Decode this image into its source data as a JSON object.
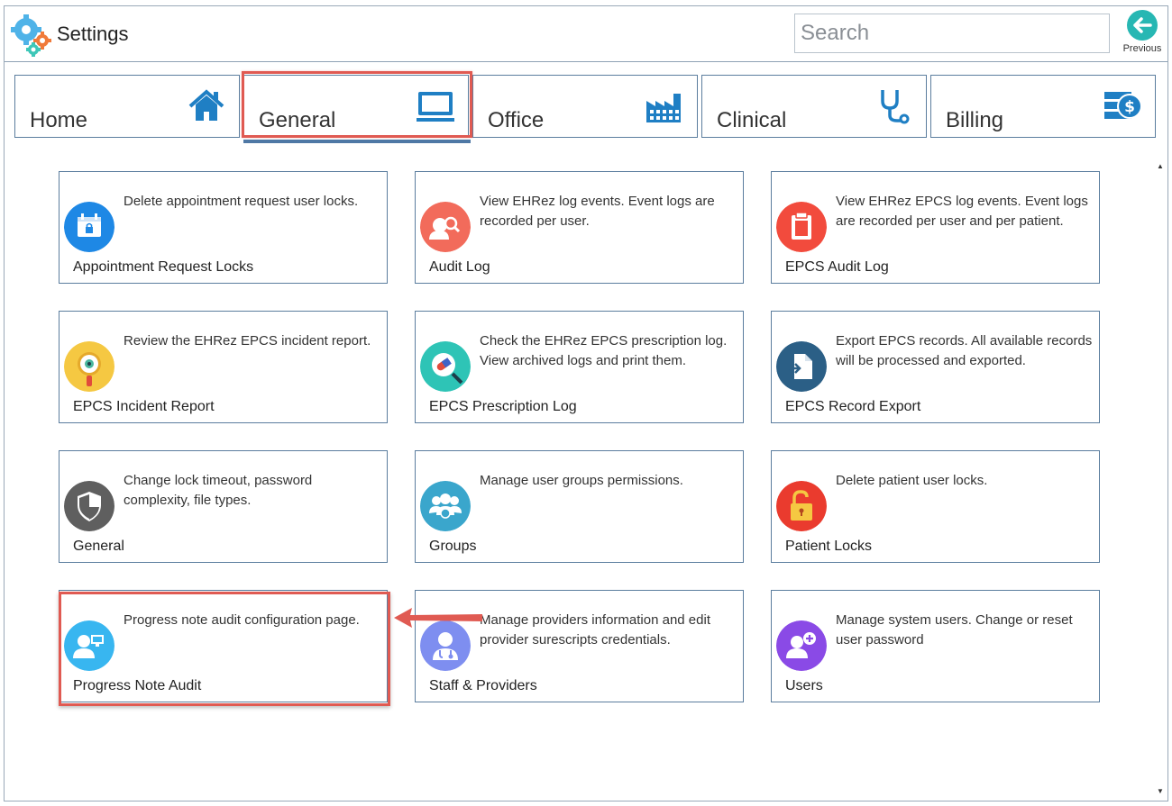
{
  "app": {
    "title": "Settings"
  },
  "search": {
    "placeholder": "Search"
  },
  "previous": {
    "label": "Previous"
  },
  "tabs": [
    {
      "label": "Home",
      "icon": "home-icon"
    },
    {
      "label": "General",
      "icon": "monitor-icon",
      "active": true
    },
    {
      "label": "Office",
      "icon": "factory-icon"
    },
    {
      "label": "Clinical",
      "icon": "stethoscope-icon"
    },
    {
      "label": "Billing",
      "icon": "billing-icon"
    }
  ],
  "tiles": [
    {
      "title": "Appointment Request Locks",
      "description": "Delete appointment request user locks.",
      "icon": "calendar-lock-icon",
      "color": "#1e88e5"
    },
    {
      "title": "Audit Log",
      "description": "View EHRez log events. Event logs are recorded per user.",
      "icon": "user-search-icon",
      "color": "#f26b5b"
    },
    {
      "title": "EPCS Audit Log",
      "description": "View EHRez EPCS log events. Event logs are recorded per user and per patient.",
      "icon": "clipboard-icon",
      "color": "#f24b3d"
    },
    {
      "title": "EPCS Incident Report",
      "description": "Review the EHRez EPCS incident report.",
      "icon": "magnifier-eye-icon",
      "color": "#f5c842"
    },
    {
      "title": "EPCS Prescription Log",
      "description": "Check the EHRez EPCS prescription log. View archived logs and print them.",
      "icon": "pill-search-icon",
      "color": "#2ec4b6"
    },
    {
      "title": "EPCS Record Export",
      "description": "Export EPCS records. All available records will be processed and exported.",
      "icon": "export-document-icon",
      "color": "#2b5f86"
    },
    {
      "title": "General",
      "description": "Change lock timeout, password complexity, file types.",
      "icon": "shield-icon",
      "color": "#5f5f5f"
    },
    {
      "title": "Groups",
      "description": "Manage user groups permissions.",
      "icon": "group-icon",
      "color": "#3aa6cc"
    },
    {
      "title": "Patient Locks",
      "description": "Delete patient user locks.",
      "icon": "padlock-open-icon",
      "color": "#ea3b2e"
    },
    {
      "title": "Progress Note Audit",
      "description": "Progress note audit configuration page.",
      "icon": "user-monitor-icon",
      "color": "#38b6f0"
    },
    {
      "title": "Staff & Providers",
      "description": "Manage providers information and edit provider surescripts credentials.",
      "icon": "doctor-icon",
      "color": "#7e8ef0"
    },
    {
      "title": "Users",
      "description": "Manage system users. Change or reset user password",
      "icon": "user-add-icon",
      "color": "#8a4ae6"
    }
  ]
}
